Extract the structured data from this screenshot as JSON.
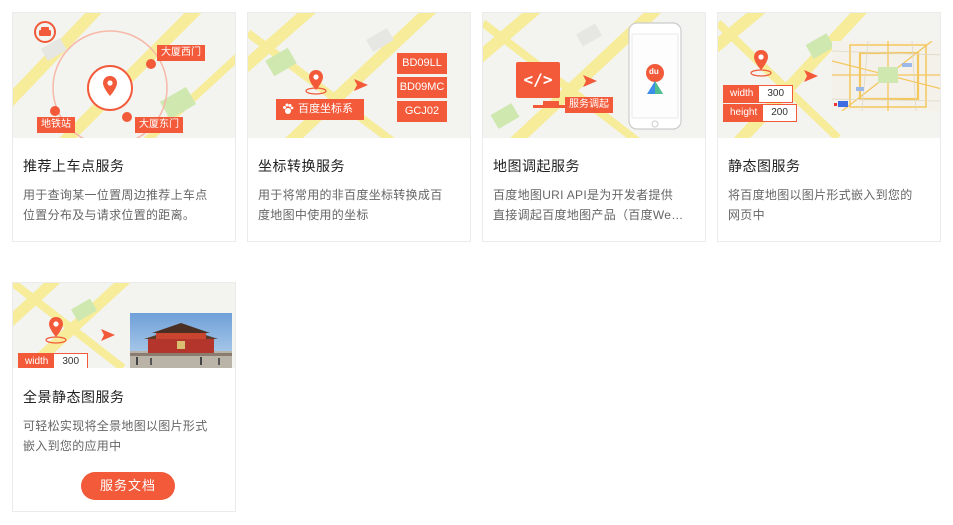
{
  "cards": [
    {
      "title": "推荐上车点服务",
      "desc_lines": [
        "用于查询某一位置周边推荐上车点",
        "位置分布及与请求位置的距离。"
      ],
      "tags": [
        "大厦西门",
        "地铁站",
        "大厦东门"
      ]
    },
    {
      "title": "坐标转换服务",
      "desc_lines": [
        "用于将常用的非百度坐标转换成百",
        "度地图中使用的坐标"
      ],
      "source_label": "百度坐标系",
      "coord_types": [
        "BD09LL",
        "BD09MC",
        "GCJ02"
      ]
    },
    {
      "title": "地图调起服务",
      "desc_lines": [
        "百度地图URI API是为开发者提供",
        "直接调起百度地图产品（百度We…"
      ],
      "code_glyph": "</>",
      "invoke_label": "服务调起",
      "app_label": "du"
    },
    {
      "title": "静态图服务",
      "desc_lines": [
        "将百度地图以图片形式嵌入到您的",
        "网页中"
      ],
      "params": [
        {
          "key": "width",
          "value": "300"
        },
        {
          "key": "height",
          "value": "200"
        }
      ]
    },
    {
      "title": "全景静态图服务",
      "desc_lines": [
        "可轻松实现将全景地图以图片形式",
        "嵌入到您的应用中"
      ],
      "params": [
        {
          "key": "width",
          "value": "300"
        }
      ],
      "button_label": "服务文档"
    }
  ],
  "colors": {
    "accent": "#f25a3a",
    "road_yellow": "#f6ec9a",
    "park_green": "#cfe8b0"
  },
  "icons": [
    "car-icon",
    "map-pin-icon",
    "baidu-paw-icon",
    "code-icon",
    "arrow-right-icon",
    "phone-icon",
    "map-thumbnail-icon",
    "tiananmen-photo-icon"
  ]
}
